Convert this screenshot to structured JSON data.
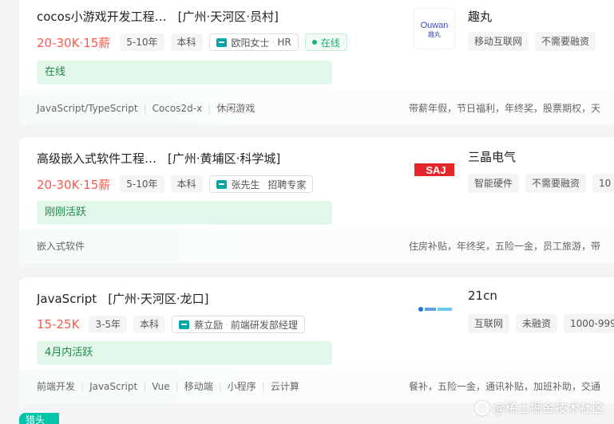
{
  "jobs": [
    {
      "name": "cocos小游戏开发工程…",
      "area": "[广州·天河区·员村]",
      "salary": "20-30K·15薪",
      "experience": "5-10年",
      "degree": "本科",
      "hr_name": "欧阳女士",
      "hr_title": "HR",
      "online_label": "在线",
      "active": "在线",
      "skills": [
        "JavaScript/TypeScript",
        "Cocos2d-x",
        "休闲游戏"
      ],
      "benefits": "带薪年假，节日福利，年终奖，股票期权，天",
      "company": "趣丸",
      "company_tags": [
        "移动互联网",
        "不需要融资"
      ],
      "logo_text": "Ouwan",
      "logo_sub": "趣丸"
    },
    {
      "name": "高级嵌入式软件工程…",
      "area": "[广州·黄埔区·科学城]",
      "salary": "20-30K·15薪",
      "experience": "5-10年",
      "degree": "本科",
      "hr_name": "张先生",
      "hr_title": "招聘专家",
      "active": "刚刚活跃",
      "skills": [
        "嵌入式软件"
      ],
      "benefits": "住房补贴，年终奖，五险一金，员工旅游，带",
      "company": "三晶电气",
      "company_tags": [
        "智能硬件",
        "不需要融资",
        "10"
      ],
      "logo_text": "SAJ"
    },
    {
      "name": "JavaScript",
      "area": "[广州·天河区·龙口]",
      "salary": "15-25K",
      "experience": "3-5年",
      "degree": "本科",
      "hr_name": "蔡立励",
      "hr_title": "前端研发部经理",
      "active": "4月内活跃",
      "skills": [
        "前端开发",
        "JavaScript",
        "Vue",
        "移动端",
        "小程序",
        "云计算"
      ],
      "benefits": "餐补，五险一金，通讯补贴，加班补助，交通",
      "company": "21cn",
      "company_tags": [
        "互联网",
        "未融资",
        "1000-999"
      ]
    }
  ],
  "watermark": "@稀土掘金技术社区",
  "corner_badge": "猎头",
  "colors": {
    "salary": "#fe574a",
    "online": "#15b374",
    "active_bg": "#e3f6ea",
    "hr_icon": "#00a6a7",
    "saj_red": "#e5262b"
  }
}
